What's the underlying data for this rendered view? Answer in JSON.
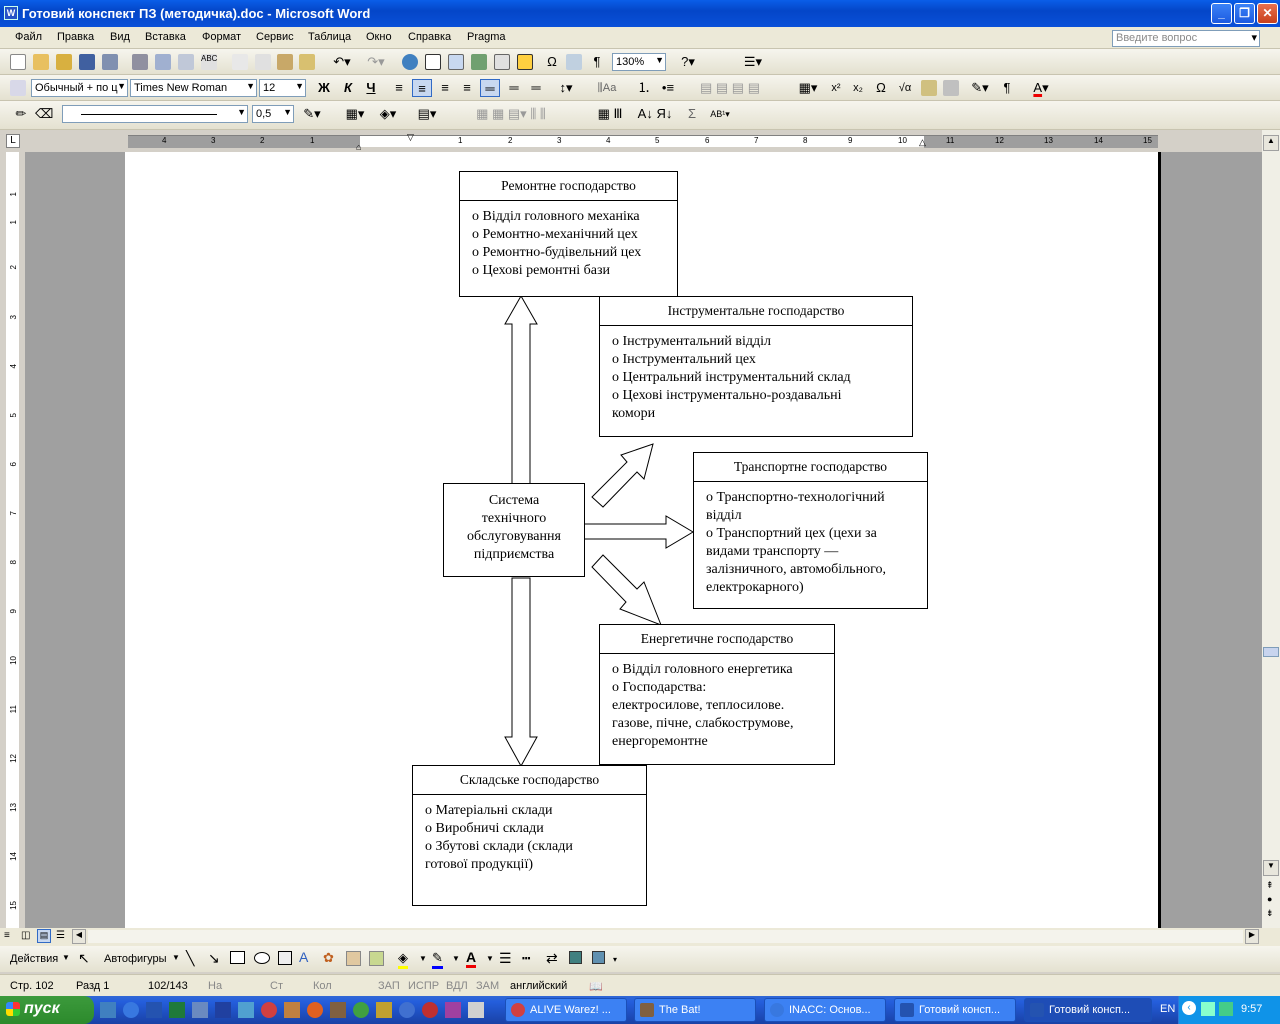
{
  "window": {
    "title": "Готовий конспект ПЗ (методичка).doc - Microsoft Word",
    "app_icon": "W"
  },
  "menubar": {
    "items": [
      "Файл",
      "Правка",
      "Вид",
      "Вставка",
      "Формат",
      "Сервис",
      "Таблица",
      "Окно",
      "Справка",
      "Pragma"
    ],
    "ask_placeholder": "Введите вопрос"
  },
  "toolbar": {
    "zoom": "130%",
    "style": "Обычный + по ц",
    "font": "Times New Roman",
    "size": "12",
    "bold": "Ж",
    "italic": "К",
    "underline": "Ч",
    "line_width": "0,5"
  },
  "ruler": {
    "h_labels": [
      "4",
      "3",
      "2",
      "1",
      "1",
      "2",
      "3",
      "4",
      "5",
      "6",
      "7",
      "8",
      "9",
      "10",
      "11",
      "12",
      "13",
      "14",
      "15",
      "16"
    ],
    "v_labels": [
      "1",
      "1",
      "2",
      "3",
      "4",
      "5",
      "6",
      "7",
      "8",
      "9",
      "10",
      "11",
      "12",
      "13",
      "14",
      "15"
    ]
  },
  "diagram": {
    "center": {
      "lines": [
        "Система",
        "технічного",
        "обслуговування",
        "підприємства"
      ]
    },
    "boxes": [
      {
        "title": "Ремонтне господарство",
        "items": [
          "о Відділ головного механіка",
          "о Ремонтно-механічний цех",
          "о Ремонтно-будівельний цех",
          "о Цехові ремонтні бази"
        ]
      },
      {
        "title": "Інструментальне господарство",
        "items": [
          "о Інструментальний відділ",
          "о Інструментальний цех",
          "о Центральний інструментальний склад",
          "о Цехові інструментально-роздавальні",
          "комори"
        ]
      },
      {
        "title": "Транспортне господарство",
        "items": [
          "о Транспортно-технологічний",
          "відділ",
          "о Транспортний цех (цехи за",
          "видами транспорту —",
          "залізничного, автомобільного,",
          "електрокарного)"
        ]
      },
      {
        "title": "Енергетичне господарство",
        "items": [
          "о Відділ головного енергетика",
          "о Господарства:",
          "електросилове, теплосилове.",
          "газове, пічне, слабкострумове,",
          "енергоремонтне"
        ]
      },
      {
        "title": "Складське господарство",
        "items": [
          "о Матеріальні склади",
          "о Виробничі склади",
          "о Збутові склади (склади",
          "готової продукції)"
        ]
      }
    ]
  },
  "drawbar": {
    "actions": "Действия",
    "autoshapes": "Автофигуры"
  },
  "status": {
    "page": "Стр. 102",
    "section": "Разд 1",
    "pages": "102/143",
    "at": "На",
    "line": "Ст",
    "col": "Кол",
    "rec": "ЗАП",
    "trk": "ИСПР",
    "ext": "ВДЛ",
    "ovr": "ЗАМ",
    "lang": "английский"
  },
  "taskbar": {
    "start": "пуск",
    "tasks": [
      "ALIVE Warez! ...",
      "The Bat!",
      "INACC: Основ...",
      "Готовий консп...",
      "Готовий консп..."
    ],
    "lang": "EN",
    "clock": "9:57"
  }
}
